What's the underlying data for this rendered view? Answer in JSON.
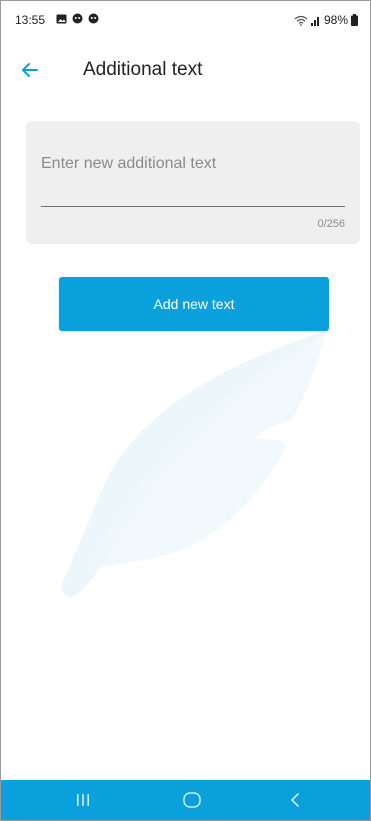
{
  "status_bar": {
    "time": "13:55",
    "battery": "98%",
    "left_icons": [
      "gallery-icon",
      "notification-icon",
      "notification-icon"
    ],
    "right_icons": [
      "wifi-icon",
      "signal-icon",
      "battery-icon"
    ]
  },
  "app_bar": {
    "back_icon": "arrow-left-icon",
    "title": "Additional text"
  },
  "form": {
    "input_value": "",
    "input_placeholder": "Enter new additional text",
    "counter": "0/256"
  },
  "actions": {
    "add_label": "Add new text"
  },
  "nav_bar": {
    "buttons": [
      "recent-apps-icon",
      "home-icon",
      "back-icon"
    ]
  },
  "colors": {
    "accent": "#0aa0dc",
    "card_background": "#efefef",
    "placeholder": "#8a8a8a"
  }
}
